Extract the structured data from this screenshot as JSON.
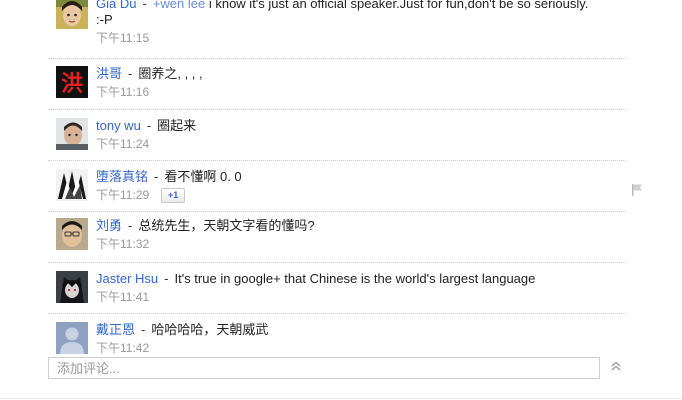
{
  "comments": [
    {
      "author": "Gia Du",
      "mention": "+wen lee",
      "text": "i know it's just an official speaker.Just for fun,don't be so seriously.",
      "text_cont": ":-P",
      "time": "下午11:15"
    },
    {
      "author": "洪哥",
      "text": "圈养之, , , ,",
      "time": "下午11:16"
    },
    {
      "author": "tony wu",
      "text": "圈起来",
      "time": "下午11:24"
    },
    {
      "author": "堕落真铭",
      "text": "看不懂啊 0. 0",
      "time": "下午11:29",
      "plus_one": "+1"
    },
    {
      "author": "刘勇",
      "text": "总统先生，天朝文字看的懂吗?",
      "time": "下午11:32"
    },
    {
      "author": "Jaster Hsu",
      "text": "It's true in google+ that Chinese is the world's largest language",
      "time": "下午11:41"
    },
    {
      "author": "戴正恩",
      "text": "哈哈哈哈，天朝威武",
      "time": "下午11:42"
    }
  ],
  "separator": "-",
  "comment_box": {
    "placeholder": "添加评论..."
  },
  "avatar_logo": "洪",
  "colors": {
    "author": "#3366cc",
    "timestamp": "#999999",
    "divider": "#cfcfcf"
  },
  "icons": {
    "flag": "flag-icon",
    "collapse": "double-chevron-up-icon"
  }
}
